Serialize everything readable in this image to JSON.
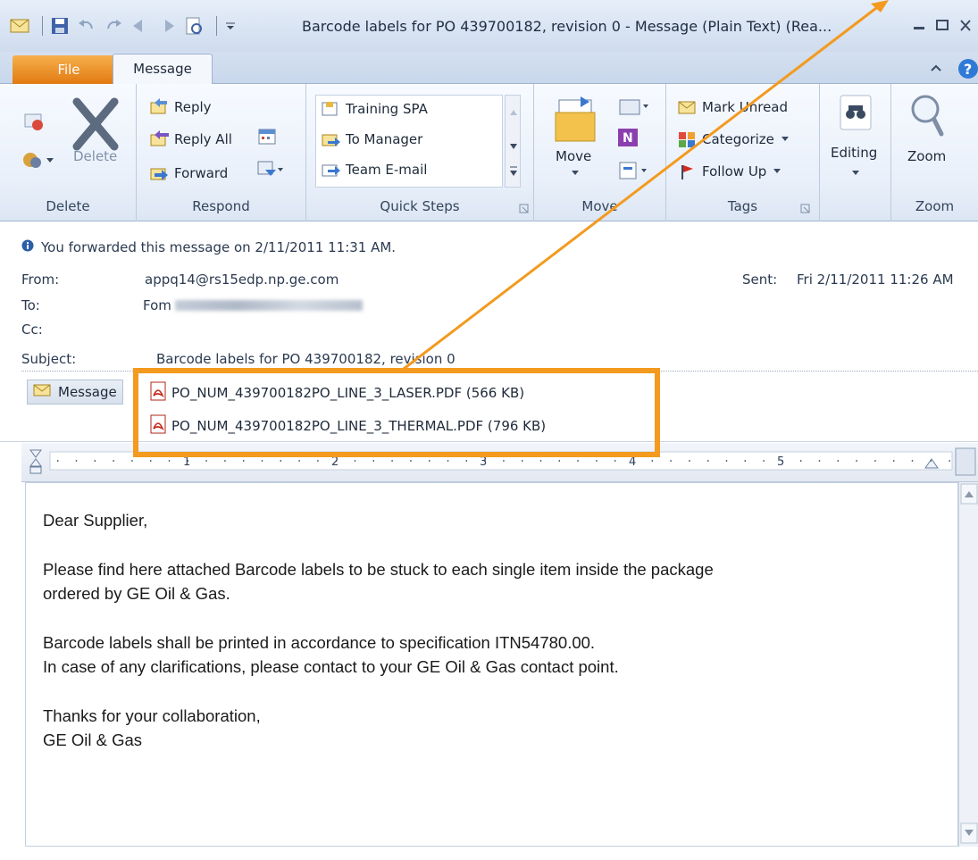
{
  "window": {
    "title": "Barcode labels for PO 439700182, revision 0  -  Message (Plain Text) (Rea..."
  },
  "tabs": {
    "file": "File",
    "message": "Message"
  },
  "ribbon": {
    "delete_group": {
      "delete_label": "Delete",
      "group_label": "Delete"
    },
    "respond_group": {
      "reply": "Reply",
      "reply_all": "Reply All",
      "forward": "Forward",
      "group_label": "Respond"
    },
    "quick_steps": {
      "items": [
        "Training SPA",
        "To Manager",
        "Team E-mail"
      ],
      "group_label": "Quick Steps"
    },
    "move_group": {
      "move_label": "Move",
      "group_label": "Move"
    },
    "tags_group": {
      "mark_unread": "Mark Unread",
      "categorize": "Categorize",
      "follow_up": "Follow Up",
      "group_label": "Tags"
    },
    "editing_group": {
      "editing_label": "Editing"
    },
    "zoom_group": {
      "zoom_label": "Zoom",
      "group_label": "Zoom"
    }
  },
  "message_header": {
    "info_bar": "You forwarded this message on 2/11/2011 11:31 AM.",
    "from_label": "From:",
    "from_value": "appq14@rs15edp.np.ge.com",
    "to_label": "To:",
    "to_value": "Fom",
    "cc_label": "Cc:",
    "subject_label": "Subject:",
    "subject_value": "Barcode labels for PO 439700182, revision 0",
    "sent_label": "Sent:",
    "sent_value": "Fri 2/11/2011 11:26 AM",
    "message_tab": "Message",
    "attachments": [
      "PO_NUM_439700182PO_LINE_3_LASER.PDF (566 KB)",
      "PO_NUM_439700182PO_LINE_3_THERMAL.PDF (796 KB)"
    ]
  },
  "ruler": {
    "marks": [
      "1",
      "2",
      "3",
      "4",
      "5"
    ]
  },
  "body": {
    "greeting": "Dear Supplier,",
    "p1_line1": "Please find here attached Barcode labels to be stuck to each single item inside the package",
    "p1_line2": "ordered by GE Oil & Gas.",
    "p2_line1": "Barcode labels shall be printed in accordance to specification ITN54780.00.",
    "p2_line2": "In case of any clarifications, please contact to your GE Oil & Gas contact point.",
    "closing": "Thanks for your collaboration,",
    "signature": "GE Oil & Gas"
  },
  "colors": {
    "annotation": "#f39a1f",
    "file_tab": "#e8841c",
    "ribbon_bg": "#e9f0fa"
  },
  "icons": [
    "mail-icon",
    "save-icon",
    "undo-icon",
    "redo-icon",
    "up-icon",
    "down-icon",
    "print-preview-icon",
    "info-icon",
    "pdf-icon",
    "help-icon"
  ]
}
